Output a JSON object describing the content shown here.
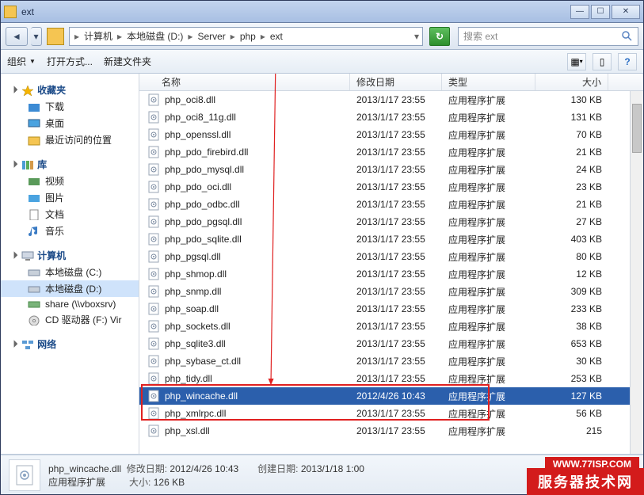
{
  "window": {
    "title": "ext"
  },
  "breadcrumbs": [
    "计算机",
    "本地磁盘 (D:)",
    "Server",
    "php",
    "ext"
  ],
  "search": {
    "placeholder": "搜索 ext"
  },
  "toolbar": {
    "organize": "组织",
    "open_with": "打开方式...",
    "new_folder": "新建文件夹"
  },
  "columns": {
    "name": "名称",
    "date": "修改日期",
    "type": "类型",
    "size": "大小"
  },
  "sidebar": {
    "favorites": {
      "label": "收藏夹",
      "items": [
        "下载",
        "桌面",
        "最近访问的位置"
      ]
    },
    "libraries": {
      "label": "库",
      "items": [
        "视频",
        "图片",
        "文档",
        "音乐"
      ]
    },
    "computer": {
      "label": "计算机",
      "items": [
        "本地磁盘 (C:)",
        "本地磁盘 (D:)",
        "share (\\\\vboxsrv)",
        "CD 驱动器 (F:) Vir"
      ]
    },
    "network": {
      "label": "网络"
    }
  },
  "type_label": "应用程序扩展",
  "files": [
    {
      "name": "php_oci8.dll",
      "date": "2013/1/17 23:55",
      "size": "130 KB"
    },
    {
      "name": "php_oci8_11g.dll",
      "date": "2013/1/17 23:55",
      "size": "131 KB"
    },
    {
      "name": "php_openssl.dll",
      "date": "2013/1/17 23:55",
      "size": "70 KB"
    },
    {
      "name": "php_pdo_firebird.dll",
      "date": "2013/1/17 23:55",
      "size": "21 KB"
    },
    {
      "name": "php_pdo_mysql.dll",
      "date": "2013/1/17 23:55",
      "size": "24 KB"
    },
    {
      "name": "php_pdo_oci.dll",
      "date": "2013/1/17 23:55",
      "size": "23 KB"
    },
    {
      "name": "php_pdo_odbc.dll",
      "date": "2013/1/17 23:55",
      "size": "21 KB"
    },
    {
      "name": "php_pdo_pgsql.dll",
      "date": "2013/1/17 23:55",
      "size": "27 KB"
    },
    {
      "name": "php_pdo_sqlite.dll",
      "date": "2013/1/17 23:55",
      "size": "403 KB"
    },
    {
      "name": "php_pgsql.dll",
      "date": "2013/1/17 23:55",
      "size": "80 KB"
    },
    {
      "name": "php_shmop.dll",
      "date": "2013/1/17 23:55",
      "size": "12 KB"
    },
    {
      "name": "php_snmp.dll",
      "date": "2013/1/17 23:55",
      "size": "309 KB"
    },
    {
      "name": "php_soap.dll",
      "date": "2013/1/17 23:55",
      "size": "233 KB"
    },
    {
      "name": "php_sockets.dll",
      "date": "2013/1/17 23:55",
      "size": "38 KB"
    },
    {
      "name": "php_sqlite3.dll",
      "date": "2013/1/17 23:55",
      "size": "653 KB"
    },
    {
      "name": "php_sybase_ct.dll",
      "date": "2013/1/17 23:55",
      "size": "30 KB"
    },
    {
      "name": "php_tidy.dll",
      "date": "2013/1/17 23:55",
      "size": "253 KB"
    },
    {
      "name": "php_wincache.dll",
      "date": "2012/4/26 10:43",
      "size": "127 KB",
      "selected": true
    },
    {
      "name": "php_xmlrpc.dll",
      "date": "2013/1/17 23:55",
      "size": "56 KB"
    },
    {
      "name": "php_xsl.dll",
      "date": "2013/1/17 23:55",
      "size": "215"
    }
  ],
  "status": {
    "file": "php_wincache.dll",
    "type": "应用程序扩展",
    "mod_label": "修改日期:",
    "mod_value": "2012/4/26 10:43",
    "size_label": "大小:",
    "size_value": "126 KB",
    "create_label": "创建日期:",
    "create_value": "2013/1/18 1:00"
  },
  "watermark": {
    "url": "WWW.77ISP.COM",
    "brand": "服务器技术网"
  }
}
